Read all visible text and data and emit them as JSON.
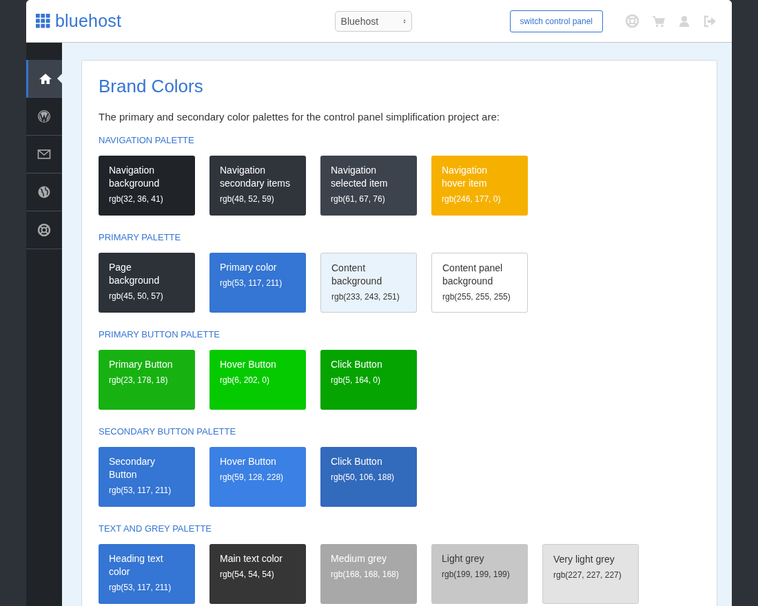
{
  "header": {
    "logo": "bluehost",
    "account_select": {
      "value": "Bluehost"
    },
    "switch_button": "switch control panel"
  },
  "sidebar": {
    "items": [
      {
        "kind": "home",
        "selected": true
      },
      {
        "kind": "wordpress",
        "selected": false
      },
      {
        "kind": "mail",
        "selected": false
      },
      {
        "kind": "globe",
        "selected": false
      },
      {
        "kind": "lifebuoy",
        "selected": false
      }
    ]
  },
  "content": {
    "title": "Brand Colors",
    "intro": "The primary and secondary color palettes for the control panel simplification project are:",
    "palettes": [
      {
        "title": "NAVIGATION PALETTE",
        "swatches": [
          {
            "name": "Navigation background",
            "value": "rgb(32, 36, 41)",
            "color": "#202429"
          },
          {
            "name": "Navigation secondary items",
            "value": "rgb(48, 52, 59)",
            "color": "#30343b"
          },
          {
            "name": "Navigation selected item",
            "value": "rgb(61, 67, 76)",
            "color": "#3d434c"
          },
          {
            "name": "Navigation hover item",
            "value": "rgb(246, 177, 0)",
            "color": "#f6b100"
          }
        ]
      },
      {
        "title": "PRIMARY PALETTE",
        "swatches": [
          {
            "name": "Page background",
            "value": "rgb(45, 50, 57)",
            "color": "#2d3239"
          },
          {
            "name": "Primary color",
            "value": "rgb(53, 117, 211)",
            "color": "#3575d3"
          },
          {
            "name": "Content background",
            "value": "rgb(233, 243, 251)",
            "color": "#e9f3fb"
          },
          {
            "name": "Content panel background",
            "value": "rgb(255, 255, 255)",
            "color": "#ffffff"
          }
        ]
      },
      {
        "title": "PRIMARY BUTTON PALETTE",
        "swatches": [
          {
            "name": "Primary Button",
            "value": "rgb(23, 178, 18)",
            "color": "#17b212"
          },
          {
            "name": "Hover Button",
            "value": "rgb(6, 202, 0)",
            "color": "#06ca00"
          },
          {
            "name": "Click Button",
            "value": "rgb(5, 164, 0)",
            "color": "#05a400"
          }
        ]
      },
      {
        "title": "SECONDARY BUTTON PALETTE",
        "swatches": [
          {
            "name": "Secondary Button",
            "value": "rgb(53, 117, 211)",
            "color": "#3575d3"
          },
          {
            "name": "Hover Button",
            "value": "rgb(59, 128, 228)",
            "color": "#3b80e4"
          },
          {
            "name": "Click Button",
            "value": "rgb(50, 106, 188)",
            "color": "#326abc"
          }
        ]
      },
      {
        "title": "TEXT AND GREY PALETTE",
        "swatches": [
          {
            "name": "Heading text color",
            "value": "rgb(53, 117, 211)",
            "color": "#3575d3"
          },
          {
            "name": "Main text color",
            "value": "rgb(54, 54, 54)",
            "color": "#363636"
          },
          {
            "name": "Medium grey",
            "value": "rgb(168, 168, 168)",
            "color": "#a8a8a8"
          },
          {
            "name": "Light grey",
            "value": "rgb(199, 199, 199)",
            "color": "#c7c7c7"
          },
          {
            "name": "Very light grey",
            "value": "rgb(227, 227, 227)",
            "color": "#e3e3e3"
          }
        ]
      }
    ]
  }
}
